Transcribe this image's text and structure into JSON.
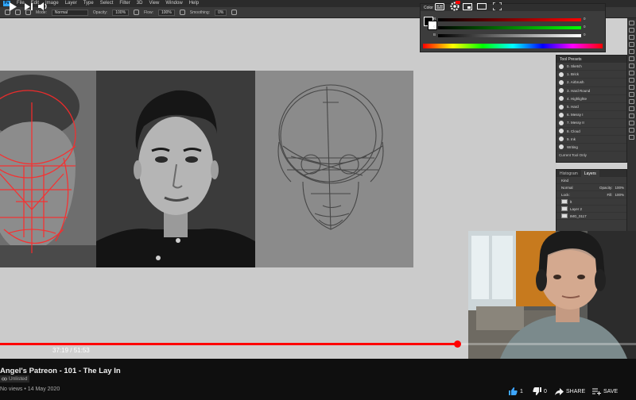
{
  "photoshop": {
    "menu": [
      "File",
      "Edit",
      "Image",
      "Layer",
      "Type",
      "Select",
      "Filter",
      "3D",
      "View",
      "Window",
      "Help"
    ],
    "options_bar": {
      "mode_label": "Mode:",
      "mode_value": "Normal",
      "opacity_label": "Opacity:",
      "opacity_value": "100%",
      "flow_label": "Flow:",
      "flow_value": "100%",
      "smoothing_label": "Smoothing:",
      "smoothing_value": "0%"
    },
    "color_panel": {
      "title": "Color",
      "channel_labels": [
        "R",
        "G",
        "B"
      ],
      "values": [
        "0",
        "0",
        "0"
      ]
    },
    "tool_presets": {
      "title": "Tool Presets",
      "items": [
        "0. Sketch",
        "1. Brick",
        "2. Airbrush",
        "3. Hard Round",
        "4. Highlighte",
        "5. Hard",
        "6. Messy I",
        "7. Messy II",
        "8. Cloud",
        "9. Ink",
        "Writing"
      ],
      "current_only": "Current Tool Only"
    },
    "layers": {
      "tabs": [
        "Histogram",
        "Layers"
      ],
      "active_tab": "Layers",
      "kind": "Kind",
      "blend_mode": "Normal",
      "opacity_label": "Opacity:",
      "opacity_value": "100%",
      "lock_label": "Lock:",
      "fill_label": "Fill:",
      "fill_value": "100%",
      "rows": [
        "lt",
        "Layer 2",
        "IMG_0117"
      ]
    }
  },
  "player": {
    "current_time": "37:19",
    "separator": " / ",
    "duration": "51:53",
    "progress_fraction": 0.719
  },
  "video_info": {
    "title": "Angel's Patreon - 101 - The Lay In",
    "badge": "Unlisted",
    "views": "No views",
    "bullet": " • ",
    "date": "14 May 2020",
    "likes": "1",
    "dislikes": "0",
    "share_label": "SHARE",
    "save_label": "SAVE"
  },
  "colors": {
    "progress": "#ff0000",
    "ps_accent": "#31a8ff",
    "construction_lines": "#ff2a2a"
  }
}
